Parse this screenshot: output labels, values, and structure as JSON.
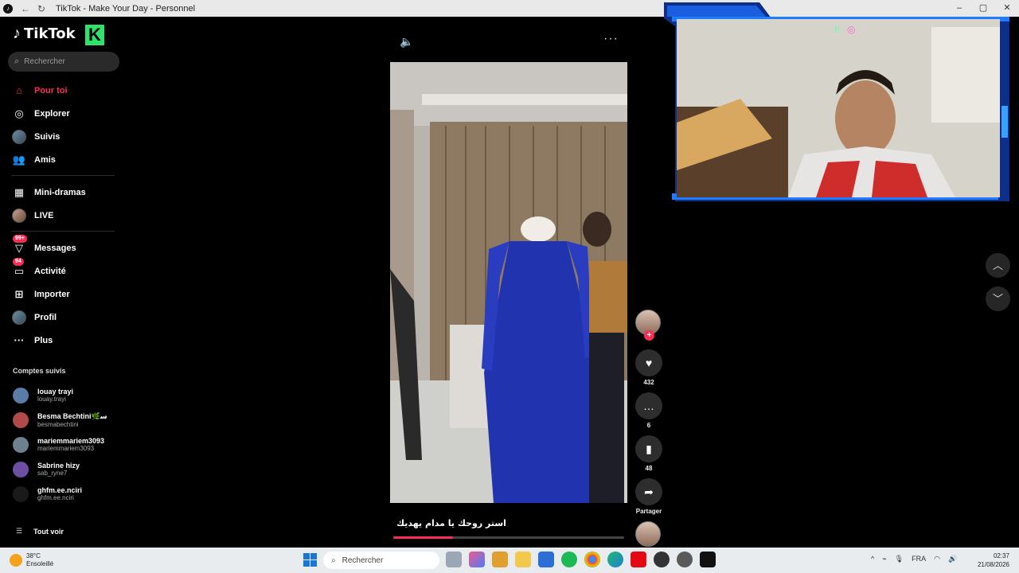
{
  "window": {
    "title": "TikTok - Make Your Day - Personnel",
    "controls": [
      "–",
      "▢",
      "✕"
    ]
  },
  "sidebar": {
    "brand": "TikTok",
    "k_badge": "K",
    "search_placeholder": "Rechercher",
    "nav": [
      {
        "label": "Pour toi",
        "icon": "home-icon",
        "active": true
      },
      {
        "label": "Explorer",
        "icon": "compass-icon"
      },
      {
        "label": "Suivis",
        "icon": "following-avatar-icon"
      },
      {
        "label": "Amis",
        "icon": "friends-icon"
      },
      {
        "label": "Mini-dramas",
        "icon": "film-icon"
      },
      {
        "label": "LIVE",
        "icon": "live-avatar-icon"
      },
      {
        "label": "Messages",
        "icon": "messages-icon",
        "badge": "99+"
      },
      {
        "label": "Activité",
        "icon": "activity-icon",
        "badge": "94"
      },
      {
        "label": "Importer",
        "icon": "upload-icon"
      },
      {
        "label": "Profil",
        "icon": "profile-avatar-icon"
      },
      {
        "label": "Plus",
        "icon": "more-icon"
      }
    ],
    "following_title": "Comptes suivis",
    "following": [
      {
        "name": "louay trayi",
        "user": "louay.trayi",
        "color": "#5a7ca8"
      },
      {
        "name": "Besma Bechtini🌿ﺳ",
        "user": "besmabechtini",
        "color": "#b34a4a"
      },
      {
        "name": "mariemmariem3093",
        "user": "mariemmariem3093",
        "color": "#6e7f8f"
      },
      {
        "name": "Sabrine hizy",
        "user": "sab_ryne7",
        "color": "#6c4fa3"
      },
      {
        "name": "ghfm.ee.nciri",
        "user": "ghfm.ee.nciri",
        "color": "#1a1a1a"
      }
    ],
    "see_all": "Tout voir"
  },
  "video": {
    "caption": "استر روحك يا مدام يهديك",
    "progress": 0.26,
    "likes": "432",
    "comments": "6",
    "saves": "48",
    "share_label": "Partager"
  },
  "taskbar": {
    "temp": "38°C",
    "weather": "Ensoleillé",
    "search_label": "Rechercher",
    "lang": "FRA",
    "time": "02:37",
    "date": "21/08/2026"
  }
}
